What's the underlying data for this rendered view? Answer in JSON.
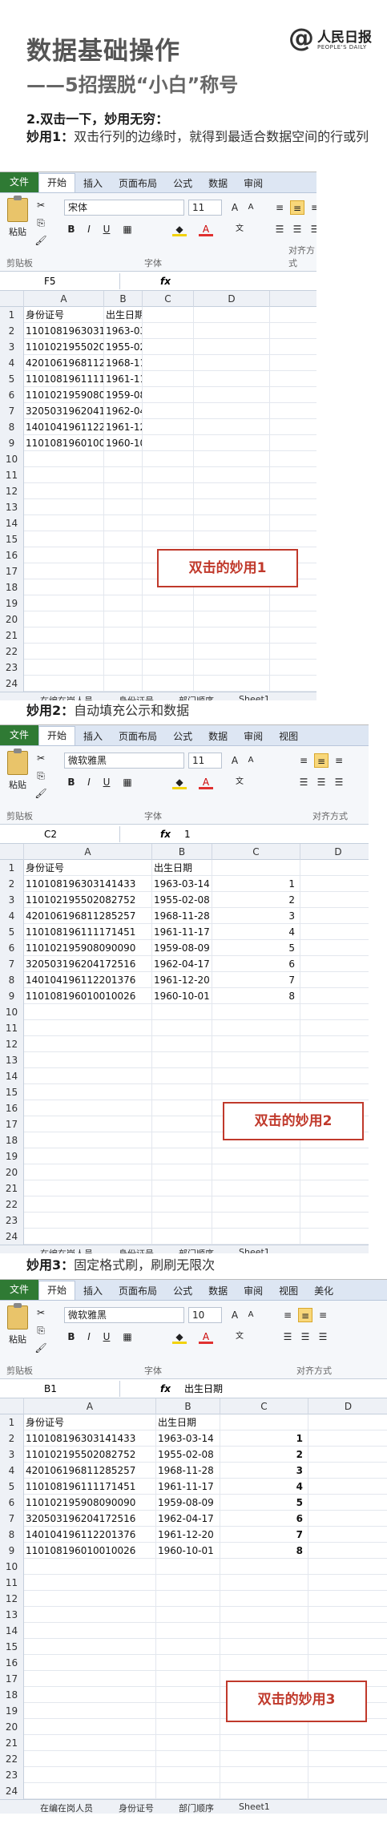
{
  "header": {
    "title_line1": "数据基础操作",
    "title_line2": "——5招摆脱“小白”称号",
    "logo_at": "@",
    "logo_name": "人民日报",
    "logo_sub": "PEOPLE'S DAILY"
  },
  "section": {
    "heading": "2.双击一下，妙用无穷：",
    "tip1_prefix": "妙用1：",
    "tip1_text": "双击行列的边缘时，就得到最适合数据空间的行或列",
    "tip2_prefix": "妙用2：",
    "tip2_text": "自动填充公示和数据",
    "tip3_prefix": "妙用3：",
    "tip3_text": "固定格式刷，刷刷无限次"
  },
  "excel": {
    "tabs": [
      "文件",
      "开始",
      "插入",
      "页面布局",
      "公式",
      "数据",
      "审阅",
      "视图",
      "美化"
    ],
    "paste_label": "粘贴",
    "clipboard_label": "剪贴板",
    "font_label": "字体",
    "align_label": "对齐方式",
    "fx_label": "fx",
    "col_headers": [
      "A",
      "B",
      "C",
      "D"
    ],
    "sheet_tabs": [
      "在编在岗人员",
      "身份证号",
      "部门顺序",
      "Sheet1"
    ],
    "header_row": [
      "身份证号",
      "出生日期"
    ],
    "ids": [
      "110108196303141433",
      "110102195502082752",
      "420106196811285257",
      "110108196111171451",
      "110102195908090090",
      "320503196204172516",
      "140104196112201376",
      "110108196010010026"
    ],
    "dates": [
      "1963-03-14",
      "1955-02-08",
      "1968-11-28",
      "1961-11-17",
      "1959-08-09",
      "1962-04-17",
      "1961-12-20",
      "1960-10-01"
    ],
    "seq": [
      "1",
      "2",
      "3",
      "4",
      "5",
      "6",
      "7",
      "8"
    ]
  },
  "shot1": {
    "font": "宋体",
    "size": "11",
    "cell": "F5",
    "formula": "",
    "callout": "双击的妙用1"
  },
  "shot2": {
    "font": "微软雅黑",
    "size": "11",
    "cell": "C2",
    "formula": "1",
    "callout": "双击的妙用2"
  },
  "shot3": {
    "font": "微软雅黑",
    "size": "10",
    "cell": "B1",
    "formula": "出生日期",
    "callout": "双击的妙用3"
  }
}
